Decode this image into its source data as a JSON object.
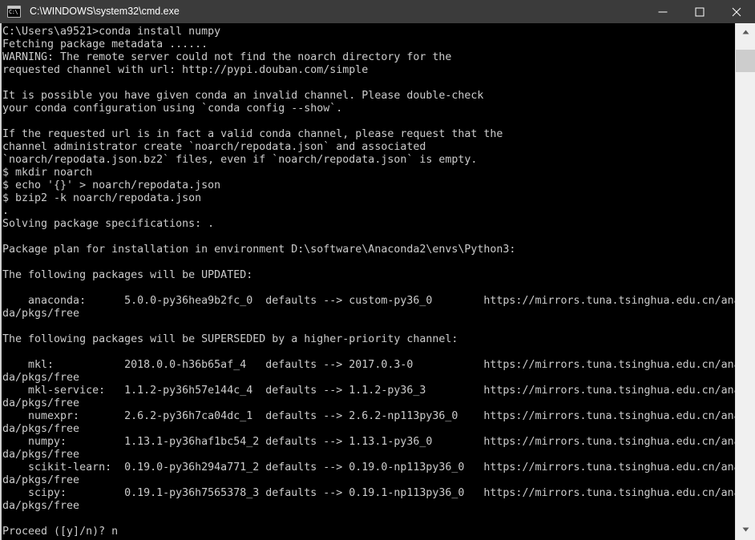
{
  "window": {
    "title": "C:\\WINDOWS\\system32\\cmd.exe",
    "icon": "cmd-console-icon",
    "background_color": "#000000",
    "titlebar_color": "#3b3b3b",
    "text_color": "#cccccc"
  },
  "titlebar_buttons": [
    {
      "name": "minimize",
      "label": "Minimize"
    },
    {
      "name": "maximize",
      "label": "Maximize"
    },
    {
      "name": "close",
      "label": "Close"
    }
  ],
  "scrollbar": {
    "up_arrow_label": "Scroll up",
    "down_arrow_label": "Scroll down",
    "thumb_label": "Scroll thumb"
  },
  "console": {
    "prompt": "C:\\Users\\a9521>",
    "command": "conda install numpy",
    "lines": [
      "C:\\Users\\a9521>conda install numpy",
      "Fetching package metadata ......",
      "WARNING: The remote server could not find the noarch directory for the",
      "requested channel with url: http://pypi.douban.com/simple",
      "",
      "It is possible you have given conda an invalid channel. Please double-check",
      "your conda configuration using `conda config --show`.",
      "",
      "If the requested url is in fact a valid conda channel, please request that the",
      "channel administrator create `noarch/repodata.json` and associated",
      "`noarch/repodata.json.bz2` files, even if `noarch/repodata.json` is empty.",
      "$ mkdir noarch",
      "$ echo '{}' > noarch/repodata.json",
      "$ bzip2 -k noarch/repodata.json",
      ".",
      "Solving package specifications: .",
      "",
      "Package plan for installation in environment D:\\software\\Anaconda2\\envs\\Python3:",
      "",
      "The following packages will be UPDATED:",
      "",
      "    anaconda:      5.0.0-py36hea9b2fc_0  defaults --> custom-py36_0        https://mirrors.tuna.tsinghua.edu.cn/anacon",
      "da/pkgs/free",
      "",
      "The following packages will be SUPERSEDED by a higher-priority channel:",
      "",
      "    mkl:           2018.0.0-h36b65af_4   defaults --> 2017.0.3-0           https://mirrors.tuna.tsinghua.edu.cn/anacon",
      "da/pkgs/free",
      "    mkl-service:   1.1.2-py36h57e144c_4  defaults --> 1.1.2-py36_3         https://mirrors.tuna.tsinghua.edu.cn/anacon",
      "da/pkgs/free",
      "    numexpr:       2.6.2-py36h7ca04dc_1  defaults --> 2.6.2-np113py36_0    https://mirrors.tuna.tsinghua.edu.cn/anacon",
      "da/pkgs/free",
      "    numpy:         1.13.1-py36haf1bc54_2 defaults --> 1.13.1-py36_0        https://mirrors.tuna.tsinghua.edu.cn/anacon",
      "da/pkgs/free",
      "    scikit-learn:  0.19.0-py36h294a771_2 defaults --> 0.19.0-np113py36_0   https://mirrors.tuna.tsinghua.edu.cn/anacon",
      "da/pkgs/free",
      "    scipy:         0.19.1-py36h7565378_3 defaults --> 0.19.1-np113py36_0   https://mirrors.tuna.tsinghua.edu.cn/anacon",
      "da/pkgs/free",
      "",
      "Proceed ([y]/n)? n"
    ],
    "packages_updated": [
      {
        "name": "anaconda:",
        "from_version": "5.0.0-py36hea9b2fc_0",
        "channel": "defaults",
        "arrow": "-->",
        "to_version": "custom-py36_0",
        "url": "https://mirrors.tuna.tsinghua.edu.cn/anaconda/pkgs/free"
      }
    ],
    "packages_superseded": [
      {
        "name": "mkl:",
        "from_version": "2018.0.0-h36b65af_4",
        "channel": "defaults",
        "arrow": "-->",
        "to_version": "2017.0.3-0",
        "url": "https://mirrors.tuna.tsinghua.edu.cn/anaconda/pkgs/free"
      },
      {
        "name": "mkl-service:",
        "from_version": "1.1.2-py36h57e144c_4",
        "channel": "defaults",
        "arrow": "-->",
        "to_version": "1.1.2-py36_3",
        "url": "https://mirrors.tuna.tsinghua.edu.cn/anaconda/pkgs/free"
      },
      {
        "name": "numexpr:",
        "from_version": "2.6.2-py36h7ca04dc_1",
        "channel": "defaults",
        "arrow": "-->",
        "to_version": "2.6.2-np113py36_0",
        "url": "https://mirrors.tuna.tsinghua.edu.cn/anaconda/pkgs/free"
      },
      {
        "name": "numpy:",
        "from_version": "1.13.1-py36haf1bc54_2",
        "channel": "defaults",
        "arrow": "-->",
        "to_version": "1.13.1-py36_0",
        "url": "https://mirrors.tuna.tsinghua.edu.cn/anaconda/pkgs/free"
      },
      {
        "name": "scikit-learn:",
        "from_version": "0.19.0-py36h294a771_2",
        "channel": "defaults",
        "arrow": "-->",
        "to_version": "0.19.0-np113py36_0",
        "url": "https://mirrors.tuna.tsinghua.edu.cn/anaconda/pkgs/free"
      },
      {
        "name": "scipy:",
        "from_version": "0.19.1-py36h7565378_3",
        "channel": "defaults",
        "arrow": "-->",
        "to_version": "0.19.1-np113py36_0",
        "url": "https://mirrors.tuna.tsinghua.edu.cn/anaconda/pkgs/free"
      }
    ],
    "environment_path": "D:\\software\\Anaconda2\\envs\\Python3",
    "updated_header": "The following packages will be UPDATED:",
    "superseded_header": "The following packages will be SUPERSEDED by a higher-priority channel:",
    "final_prompt": "Proceed ([y]/n)? n",
    "final_answer": "n"
  }
}
